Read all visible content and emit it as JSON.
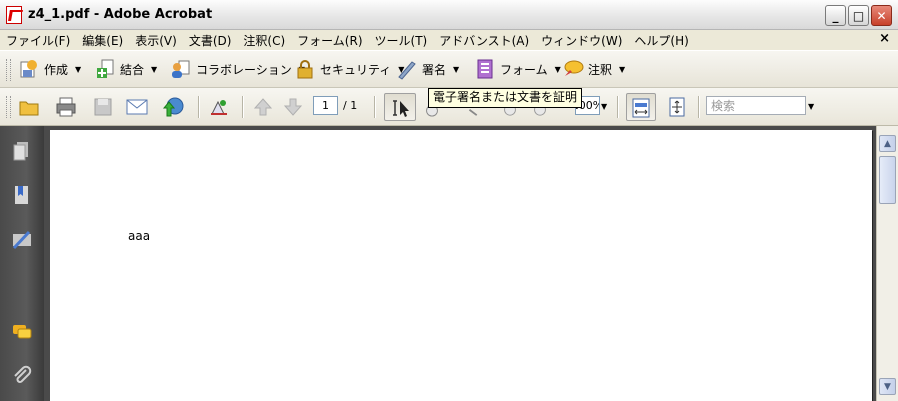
{
  "window": {
    "title": "z4_1.pdf - Adobe Acrobat",
    "min": "_",
    "max": "□",
    "close": "✕"
  },
  "menu": {
    "items": [
      "ファイル(F)",
      "編集(E)",
      "表示(V)",
      "文書(D)",
      "注釈(C)",
      "フォーム(R)",
      "ツール(T)",
      "アドバンスト(A)",
      "ウィンドウ(W)",
      "ヘルプ(H)"
    ],
    "close": "×"
  },
  "tasks": {
    "create": "作成",
    "combine": "結合",
    "collaborate": "コラボレーション",
    "security": "セキュリティ",
    "sign": "署名",
    "forms": "フォーム",
    "comment": "注釈"
  },
  "toolbar": {
    "page_current": "1",
    "page_total": "/ 1",
    "zoom": "100%",
    "search_placeholder": "検索"
  },
  "tooltip": "電子署名または文書を証明",
  "document": {
    "text": "aaa"
  },
  "colors": {
    "accent_red": "#cc0000",
    "nav_bg": "#4a4a4a",
    "tooltip_bg": "#ffffe1"
  }
}
